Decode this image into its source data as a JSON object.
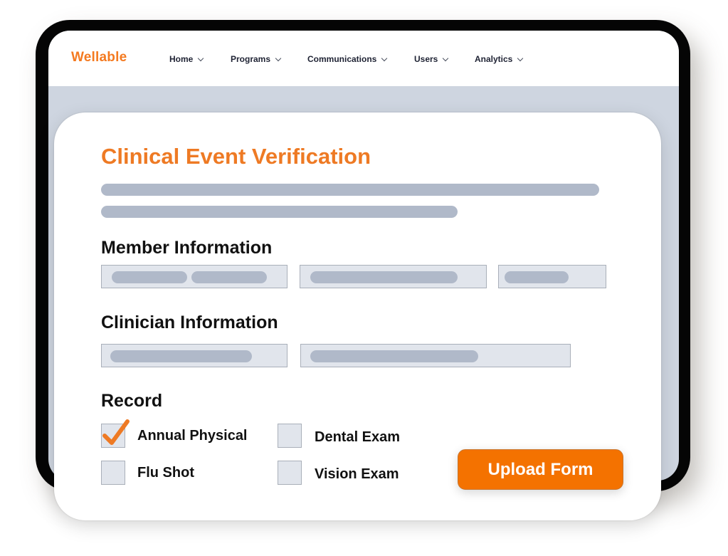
{
  "brand": {
    "logo": "Wellable",
    "accent_color": "#f47a20"
  },
  "nav": {
    "items": [
      {
        "label": "Home"
      },
      {
        "label": "Programs"
      },
      {
        "label": "Communications"
      },
      {
        "label": "Users"
      },
      {
        "label": "Analytics"
      }
    ]
  },
  "form": {
    "title": "Clinical Event Verification",
    "sections": {
      "member": "Member Information",
      "clinician": "Clinician Information",
      "record": "Record"
    },
    "record_options": [
      {
        "label": "Annual Physical",
        "checked": true
      },
      {
        "label": "Dental Exam",
        "checked": false
      },
      {
        "label": "Flu Shot",
        "checked": false
      },
      {
        "label": "Vision Exam",
        "checked": false
      }
    ],
    "upload_label": "Upload Form",
    "upload_color": "#f47200"
  }
}
